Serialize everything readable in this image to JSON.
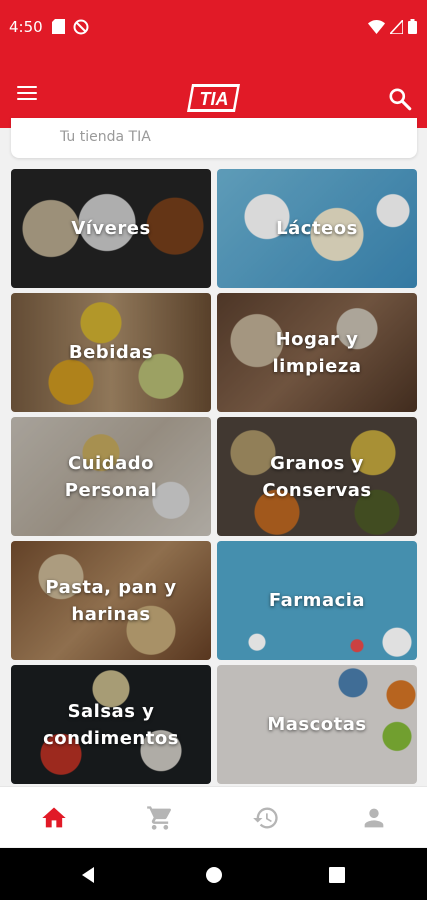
{
  "status_bar": {
    "time": "4:50",
    "icons_left": [
      "sd-card-icon",
      "no-sync-icon"
    ],
    "icons_right": [
      "wifi-icon",
      "signal-icon",
      "battery-icon"
    ]
  },
  "app_bar": {
    "logo_text": "TIA",
    "menu_icon": "menu-icon",
    "search_icon": "search-icon",
    "color": "#e11a27"
  },
  "store": {
    "placeholder": "Tu tienda TIA"
  },
  "categories": [
    {
      "label": "Víveres"
    },
    {
      "label": "Lácteos"
    },
    {
      "label": "Bebidas"
    },
    {
      "label": "Hogar y\nlimpieza"
    },
    {
      "label": "Cuidado\nPersonal"
    },
    {
      "label": "Granos y\nConservas"
    },
    {
      "label": "Pasta, pan y\nharinas"
    },
    {
      "label": "Farmacia"
    },
    {
      "label": "Salsas y\ncondimentos"
    },
    {
      "label": "Mascotas"
    }
  ],
  "bottom_nav": {
    "items": [
      {
        "icon": "home-icon",
        "active": true
      },
      {
        "icon": "cart-icon",
        "active": false
      },
      {
        "icon": "history-icon",
        "active": false
      },
      {
        "icon": "profile-icon",
        "active": false
      }
    ],
    "active_color": "#e11a27",
    "inactive_color": "#b5b5b5"
  }
}
